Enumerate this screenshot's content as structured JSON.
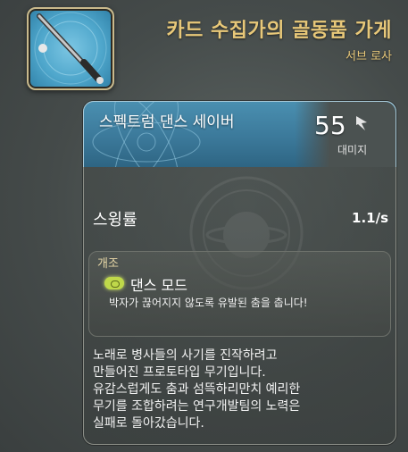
{
  "header": {
    "title": "카드 수집가의 골동품 가게",
    "subtitle": "서브 로사"
  },
  "item": {
    "name": "스펙트럼 댄스 세이버",
    "damage_value": "55",
    "damage_label": "대미지",
    "icon": "saber-icon",
    "icon_background_color": "#5fb4d8"
  },
  "stats": [
    {
      "label": "스윙률",
      "value": "1.1/s"
    }
  ],
  "mod": {
    "section_label": "개조",
    "name": "댄스 모드",
    "description": "박자가 끊어지지 않도록 유발된 춤을 춥니다!",
    "icon": "dance-mode-icon",
    "icon_color": "#bfd84a"
  },
  "description": "노래로 병사들의 사기를 진작하려고\n만들어진 프로토타입 무기입니다.\n유감스럽게도 춤과 섬뜩하리만치 예리한\n무기를 조합하려는 연구개발팀의 노력은\n실패로 돌아갔습니다.",
  "colors": {
    "accent_gold": "#e8c879",
    "header_blue": "#3a7798"
  }
}
